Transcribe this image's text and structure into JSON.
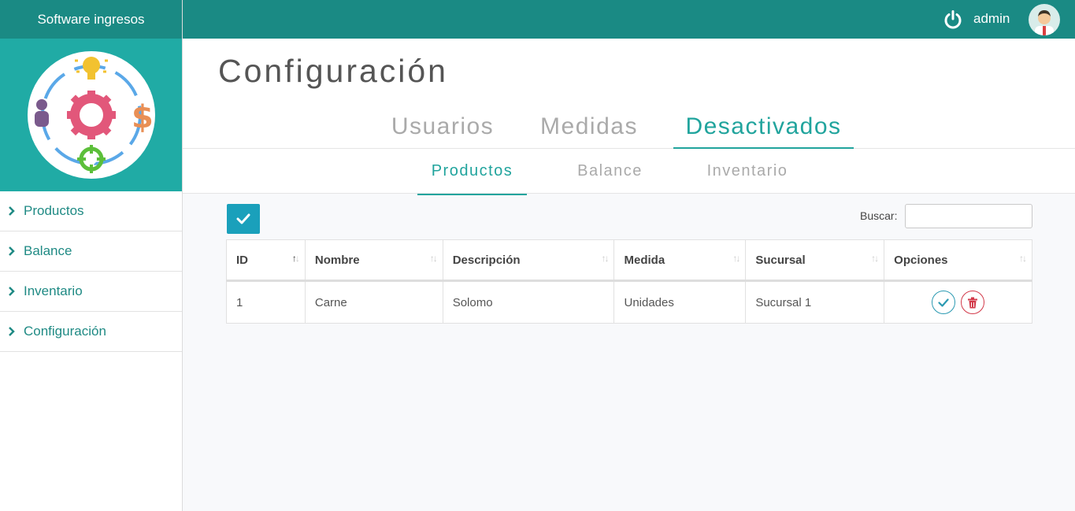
{
  "app": {
    "brand": "Software ingresos"
  },
  "user": {
    "name": "admin"
  },
  "sidebar": {
    "items": [
      {
        "label": "Productos"
      },
      {
        "label": "Balance"
      },
      {
        "label": "Inventario"
      },
      {
        "label": "Configuración"
      }
    ]
  },
  "page": {
    "title": "Configuración"
  },
  "tabs": [
    {
      "label": "Usuarios",
      "active": false
    },
    {
      "label": "Medidas",
      "active": false
    },
    {
      "label": "Desactivados",
      "active": true
    }
  ],
  "subtabs": [
    {
      "label": "Productos",
      "active": true
    },
    {
      "label": "Balance",
      "active": false
    },
    {
      "label": "Inventario",
      "active": false
    }
  ],
  "search": {
    "label": "Buscar:",
    "value": ""
  },
  "table": {
    "columns": [
      "ID",
      "Nombre",
      "Descripción",
      "Medida",
      "Sucursal",
      "Opciones"
    ],
    "rows": [
      {
        "id": "1",
        "nombre": "Carne",
        "descripcion": "Solomo",
        "medida": "Unidades",
        "sucursal": "Sucursal 1"
      }
    ]
  },
  "icons": {
    "menu_chevron": "chevron-right-icon",
    "power": "power-icon",
    "avatar": "user-avatar-icon",
    "logo": "software-logo-icon",
    "confirm": "check-icon",
    "delete": "trash-icon"
  },
  "colors": {
    "brand_dark": "#1a8a84",
    "brand": "#20aba5",
    "accent": "#21a49d",
    "button": "#1aa0bb",
    "delete": "#d23a4a"
  }
}
